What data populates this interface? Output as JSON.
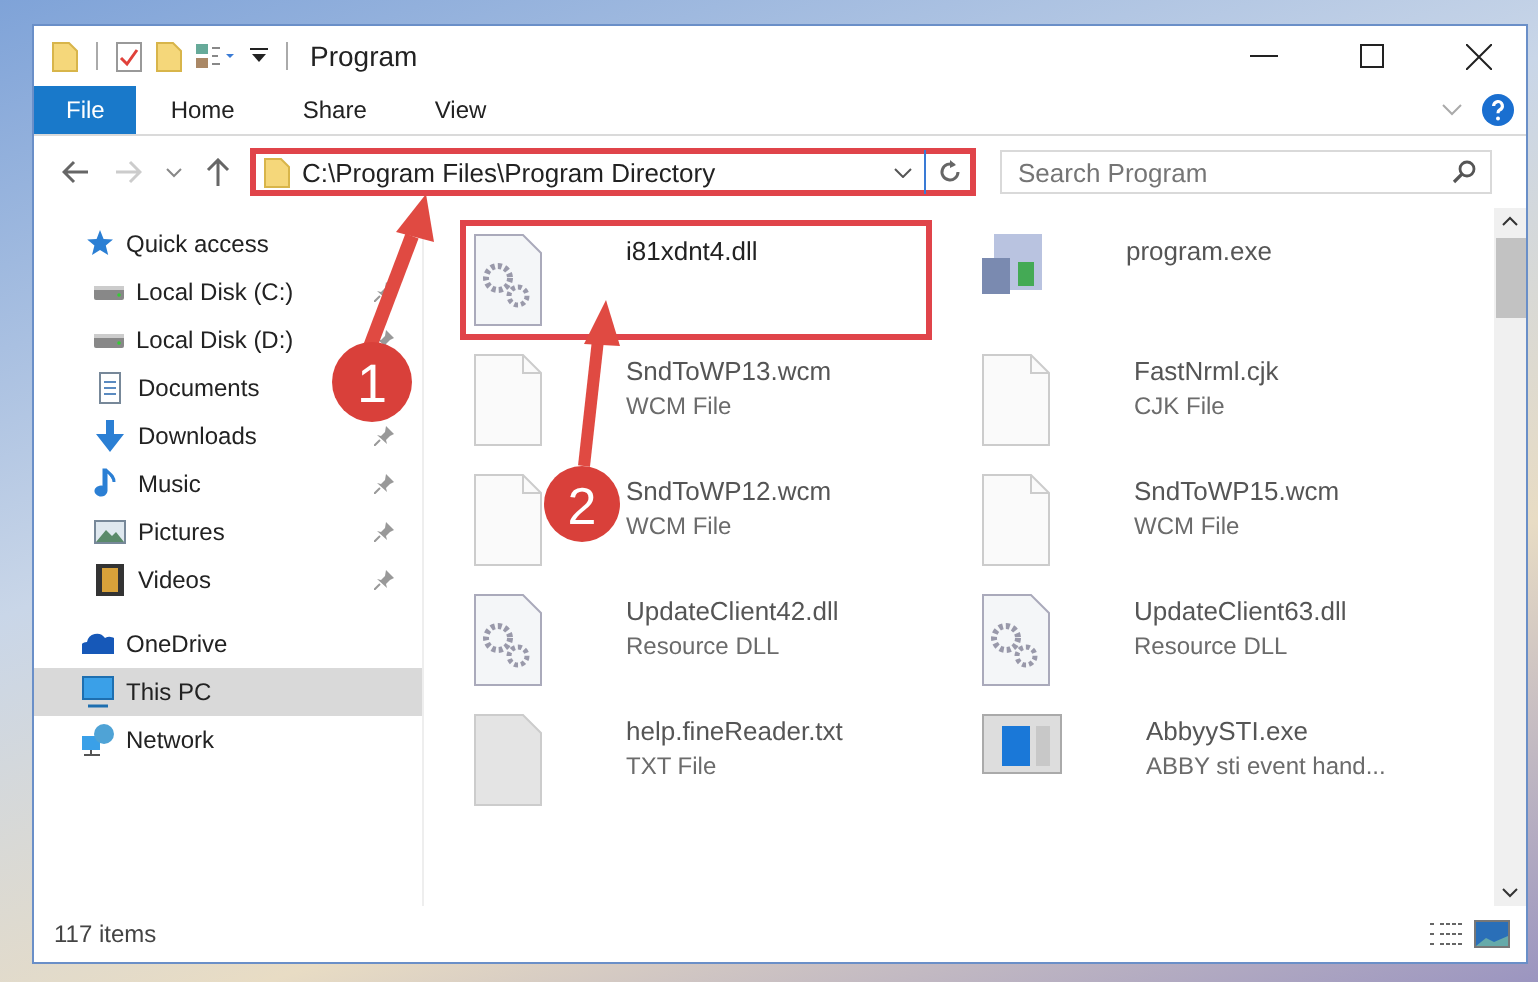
{
  "window": {
    "title": "Program"
  },
  "ribbon_tabs": [
    {
      "label": "File",
      "selected": true
    },
    {
      "label": "Home",
      "selected": false
    },
    {
      "label": "Share",
      "selected": false
    },
    {
      "label": "View",
      "selected": false
    }
  ],
  "address": {
    "path": "C:\\Program Files\\Program Directory",
    "highlighted": true
  },
  "search": {
    "placeholder": "Search Program"
  },
  "sidebar": {
    "items": [
      {
        "label": "Quick access",
        "kind": "star",
        "selected": false,
        "children": [
          {
            "label": "Local Disk (C:)",
            "kind": "disk",
            "selected": false,
            "pinned": true
          },
          {
            "label": "Local Disk (D:)",
            "kind": "disk",
            "selected": false,
            "pinned": true
          },
          {
            "label": "Documents",
            "kind": "docs",
            "selected": false,
            "pinned": false
          },
          {
            "label": "Downloads",
            "kind": "download",
            "selected": false,
            "pinned": true
          },
          {
            "label": "Music",
            "kind": "music",
            "selected": false,
            "pinned": true
          },
          {
            "label": "Pictures",
            "kind": "pictures",
            "selected": false,
            "pinned": true
          },
          {
            "label": "Videos",
            "kind": "videos",
            "selected": false,
            "pinned": true
          }
        ]
      },
      {
        "label": "OneDrive",
        "kind": "cloud",
        "selected": false
      },
      {
        "label": "This PC",
        "kind": "pc",
        "selected": true
      },
      {
        "label": "Network",
        "kind": "network",
        "selected": false
      }
    ]
  },
  "files": [
    {
      "name": "i81xdnt4.dll",
      "kind": "dll",
      "highlighted": true
    },
    {
      "name": "program.exe",
      "kind": "installer",
      "highlighted": false
    },
    {
      "name": "SndToWP13.wcm",
      "type": "WCM File",
      "kind": "blank",
      "highlighted": false
    },
    {
      "name": "FastNrml.cjk",
      "type": "CJK File",
      "kind": "blank",
      "highlighted": false
    },
    {
      "name": "SndToWP12.wcm",
      "type": "WCM File",
      "kind": "blank",
      "highlighted": false
    },
    {
      "name": "SndToWP15.wcm",
      "type": "WCM File",
      "kind": "blank",
      "highlighted": false
    },
    {
      "name": "UpdateClient42.dll",
      "type": "Resource DLL",
      "kind": "dll",
      "highlighted": false
    },
    {
      "name": "UpdateClient63.dll",
      "type": "Resource DLL",
      "kind": "dll",
      "highlighted": false
    },
    {
      "name": "help.fineReader.txt",
      "type": "TXT File",
      "kind": "text",
      "highlighted": false
    },
    {
      "name": "AbbyySTI.exe",
      "type": "ABBY sti event hand...",
      "kind": "app",
      "highlighted": false
    }
  ],
  "status_bar": {
    "count": "117 items"
  },
  "annotations": [
    {
      "label": "1"
    },
    {
      "label": "2"
    }
  ]
}
